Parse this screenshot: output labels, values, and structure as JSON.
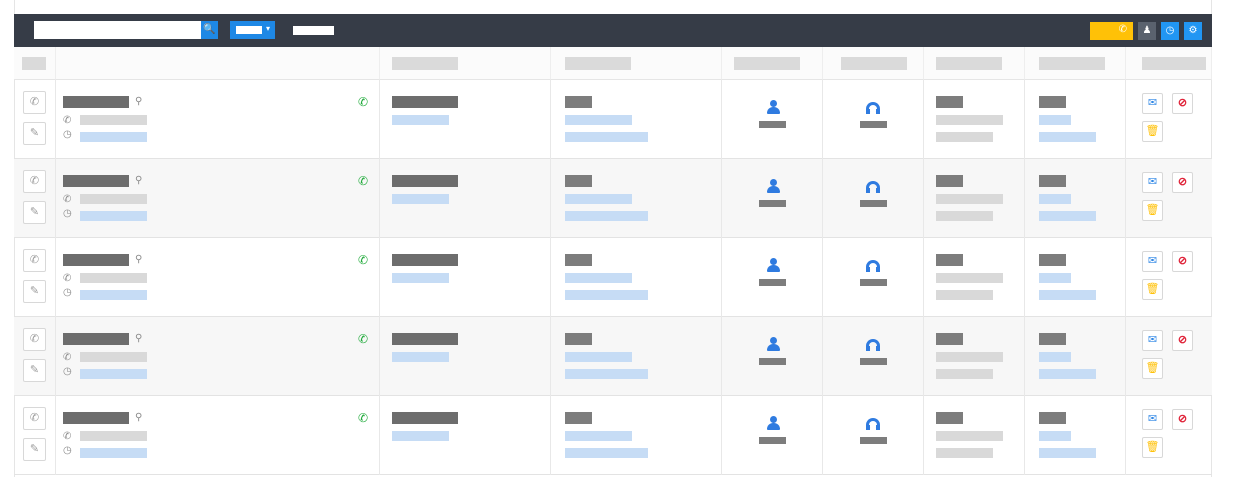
{
  "toolbar": {
    "search": {
      "placeholder": "",
      "icon": "search-icon"
    },
    "filter": {
      "icon": "caret-down-icon"
    },
    "icons": {
      "call": "phone-icon",
      "user": "user-icon",
      "clock": "clock-icon",
      "gear": "gear-icon"
    },
    "glyphs": {
      "search": "🔍",
      "caret": "▾",
      "phone": "✆",
      "user": "♟",
      "clock": "◷",
      "gear": "⚙"
    }
  },
  "row_glyphs": {
    "phone": "✆",
    "edit": "✎",
    "search": "⚲",
    "clock": "◷",
    "mail": "✉",
    "block": "⊘",
    "trash": "🗑"
  },
  "colors": {
    "toolbar_bg": "#363c47",
    "accent_blue": "#1e88e5",
    "call_yellow": "#ffc107",
    "status_green": "#1faa3a",
    "danger_red": "#e0243a"
  },
  "rows": [
    {},
    {},
    {},
    {},
    {}
  ]
}
